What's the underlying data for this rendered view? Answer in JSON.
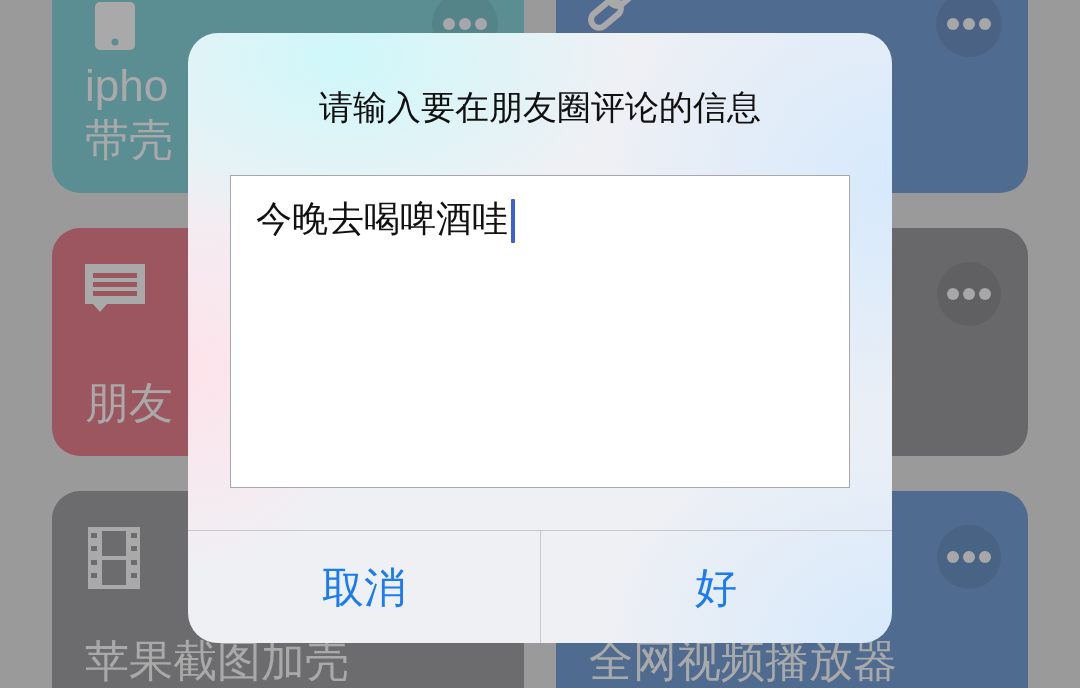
{
  "shortcuts": [
    {
      "label_lines": [
        "ipho",
        "带壳"
      ],
      "color": "#5b8e93"
    },
    {
      "color": "#506b90"
    },
    {
      "label_lines": [
        "朋友"
      ],
      "color": "#9b5660"
    },
    {
      "color": "#68686a"
    },
    {
      "label_lines": [
        "苹果截图加壳"
      ],
      "color": "#6c6c6e"
    },
    {
      "label_lines": [
        "全网视频播放器"
      ],
      "color": "#4f6b8f"
    }
  ],
  "dialog": {
    "title": "请输入要在朋友圈评论的信息",
    "input": {
      "value": "今晚去喝啤酒哇",
      "focused": true
    },
    "buttons": [
      "取消",
      "好"
    ]
  }
}
